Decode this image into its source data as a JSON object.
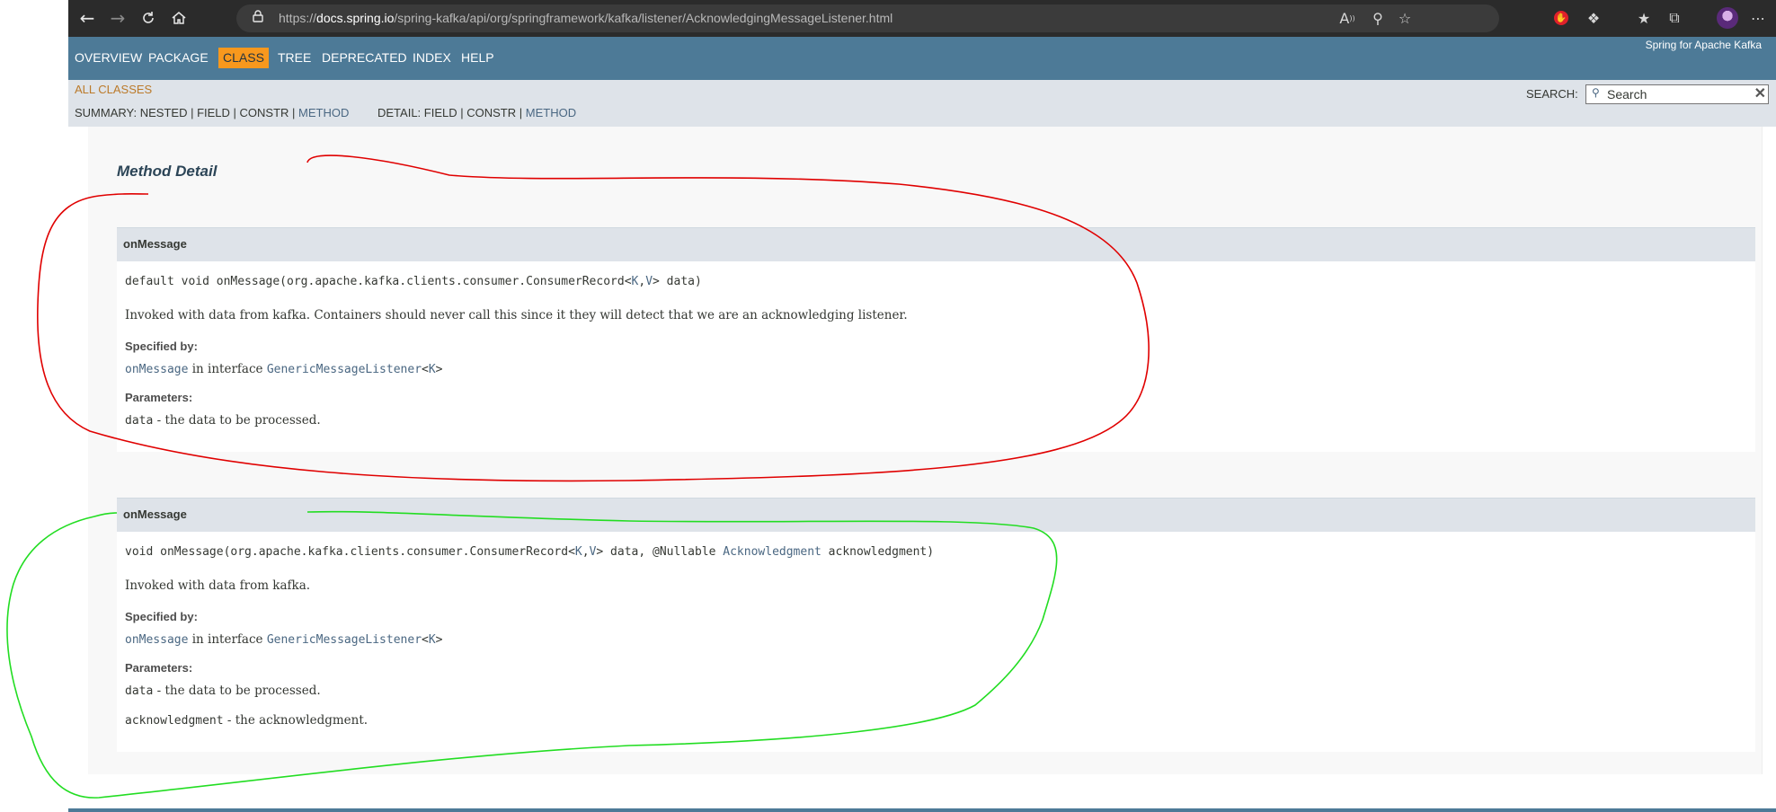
{
  "browser": {
    "url_prefix": "https://",
    "url_host": "docs.spring.io",
    "url_path": "/spring-kafka/api/org/springframework/kafka/listener/AcknowledgingMessageListener.html",
    "icons": {
      "back": "arrow-left-icon",
      "forward": "arrow-right-icon",
      "refresh": "refresh-icon",
      "home": "home-icon",
      "lock": "lock-icon",
      "read_aloud": "read-aloud-icon",
      "zoom": "zoom-icon",
      "favorite_add": "star-add-icon",
      "adblock": "adblock-icon",
      "extensions": "puzzle-icon",
      "favorites": "star-list-icon",
      "collections": "collections-icon",
      "profile": "avatar",
      "more": "ellipsis-icon"
    }
  },
  "topnav": {
    "items": [
      "OVERVIEW",
      "PACKAGE",
      "CLASS",
      "TREE",
      "DEPRECATED",
      "INDEX",
      "HELP"
    ],
    "active": "CLASS",
    "brand": "Spring for Apache Kafka"
  },
  "subnav": {
    "all_classes": "ALL CLASSES",
    "summary_label": "SUMMARY:",
    "summary_plain": "NESTED | FIELD | CONSTR |",
    "summary_link": "METHOD",
    "detail_label": "DETAIL:",
    "detail_plain": "FIELD | CONSTR |",
    "detail_link": "METHOD",
    "search_label": "SEARCH:",
    "search_placeholder": "Search"
  },
  "content": {
    "section_title": "Method Detail",
    "methods": [
      {
        "name": "onMessage",
        "sig_pre": "default void onMessage(org.apache.kafka.clients.consumer.ConsumerRecord<",
        "sig_k": "K",
        "sig_comma": ",",
        "sig_v": "V",
        "sig_post": "> data)",
        "description": "Invoked with data from kafka. Containers should never call this since it they will detect that we are an acknowledging listener.",
        "specified_by_label": "Specified by:",
        "specified_method": "onMessage",
        "specified_in": " in interface ",
        "specified_interface": "GenericMessageListener",
        "specified_lt": "<",
        "specified_k": "K",
        "specified_gt": ">",
        "params_label": "Parameters:",
        "param1_name": "data",
        "param1_desc": " - the data to be processed."
      },
      {
        "name": "onMessage",
        "sig_pre": "void onMessage(org.apache.kafka.clients.consumer.ConsumerRecord<",
        "sig_k": "K",
        "sig_comma": ",",
        "sig_v": "V",
        "sig_mid": "> data, @Nullable ",
        "sig_ack": "Acknowledgment",
        "sig_post": " acknowledgment)",
        "description": "Invoked with data from kafka.",
        "specified_by_label": "Specified by:",
        "specified_method": "onMessage",
        "specified_in": " in interface ",
        "specified_interface": "GenericMessageListener",
        "specified_lt": "<",
        "specified_k": "K",
        "specified_gt": ">",
        "params_label": "Parameters:",
        "param1_name": "data",
        "param1_desc": " - the data to be processed.",
        "param2_name": "acknowledgment",
        "param2_desc": " - the acknowledgment."
      }
    ]
  },
  "annotation_colors": {
    "red_loop": "#e00000",
    "green_loop": "#22dd22"
  }
}
